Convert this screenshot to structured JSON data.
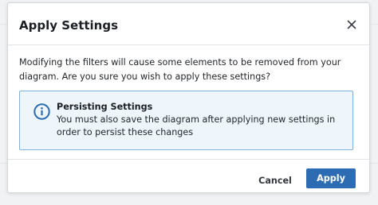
{
  "dialog": {
    "title": "Apply Settings",
    "close_icon": "close-icon",
    "message": "Modifying the filters will cause some elements to be removed from your diagram. Are you sure you wish to apply these settings?",
    "notice": {
      "icon": "info-icon",
      "title": "Persisting Settings",
      "text": "You must also save the diagram after applying new settings in order to persist these changes",
      "background": "#eef6fc",
      "border_color": "#7fb1da",
      "icon_color": "#2d6cb3"
    },
    "buttons": {
      "cancel_label": "Cancel",
      "apply_label": "Apply",
      "primary_color": "#2d6cb3"
    }
  }
}
